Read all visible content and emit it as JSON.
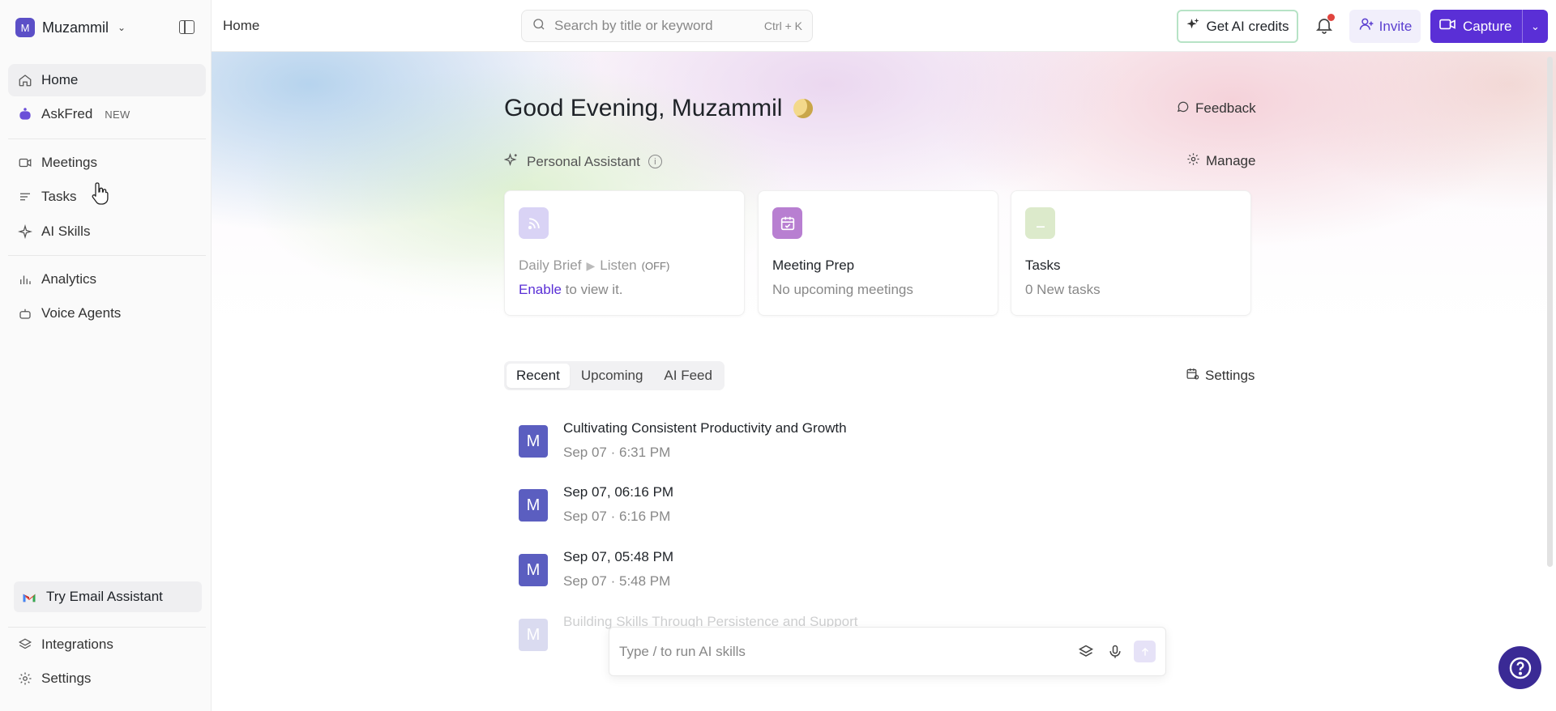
{
  "workspace": {
    "initial": "M",
    "name": "Muzammil"
  },
  "sidebar": {
    "items": [
      {
        "label": "Home",
        "icon": "home-icon",
        "active": true
      },
      {
        "label": "AskFred",
        "icon": "bot-icon",
        "badge": "NEW"
      },
      {
        "label": "Meetings",
        "icon": "video-icon"
      },
      {
        "label": "Tasks",
        "icon": "list-icon"
      },
      {
        "label": "AI Skills",
        "icon": "sparkle-icon"
      },
      {
        "label": "Analytics",
        "icon": "bar-chart-icon"
      },
      {
        "label": "Voice Agents",
        "icon": "robot-icon"
      }
    ],
    "try_email": "Try Email Assistant",
    "bottom": [
      {
        "label": "Integrations",
        "icon": "layers-icon"
      },
      {
        "label": "Settings",
        "icon": "gear-icon"
      }
    ]
  },
  "topbar": {
    "breadcrumb": "Home",
    "search_placeholder": "Search by title or keyword",
    "search_shortcut": "Ctrl + K",
    "credits_label": "Get AI credits",
    "invite_label": "Invite",
    "capture_label": "Capture"
  },
  "hero": {
    "greeting": "Good Evening, Muzammil",
    "feedback_label": "Feedback",
    "assistant_label": "Personal Assistant",
    "manage_label": "Manage"
  },
  "cards": {
    "daily": {
      "title": "Daily Brief",
      "listen": "Listen",
      "off": "(OFF)",
      "enable": "Enable",
      "sub_rest": "to view it."
    },
    "prep": {
      "title": "Meeting Prep",
      "sub": "No upcoming meetings"
    },
    "tasks": {
      "title": "Tasks",
      "sub": "0 New tasks"
    }
  },
  "tabs": {
    "items": [
      "Recent",
      "Upcoming",
      "AI Feed"
    ],
    "active": "Recent",
    "settings_label": "Settings"
  },
  "meetings": [
    {
      "avatar": "M",
      "title": "Cultivating Consistent Productivity and Growth",
      "date": "Sep 07",
      "time": "6:31 PM"
    },
    {
      "avatar": "M",
      "title": "Sep 07, 06:16 PM",
      "date": "Sep 07",
      "time": "6:16 PM"
    },
    {
      "avatar": "M",
      "title": "Sep 07, 05:48 PM",
      "date": "Sep 07",
      "time": "5:48 PM"
    },
    {
      "avatar": "M",
      "title": "Building Skills Through Persistence and Support"
    }
  ],
  "composer": {
    "placeholder": "Type / to run AI skills"
  },
  "colors": {
    "accent": "#5a2fd6",
    "avatar": "#5b5ec0",
    "help": "#3a2a95",
    "notification": "#e0443e"
  }
}
